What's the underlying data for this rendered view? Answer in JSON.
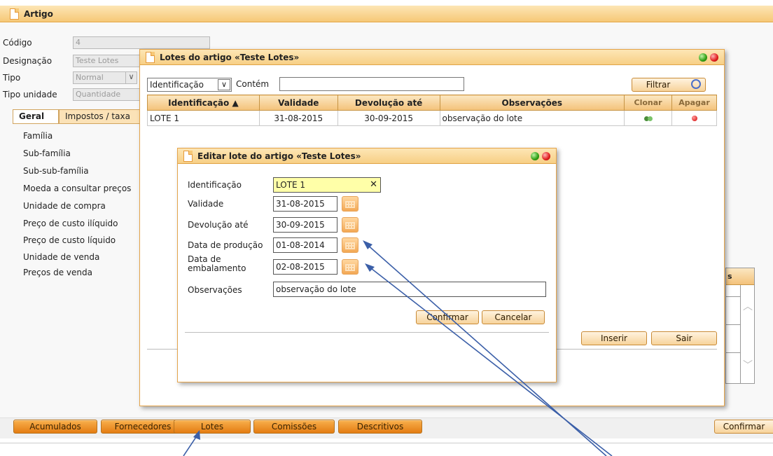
{
  "main": {
    "title": "Artigo",
    "fields": {
      "codigo_label": "Código",
      "codigo_value": "4",
      "designacao_label": "Designação",
      "designacao_value": "Teste Lotes",
      "tipo_label": "Tipo",
      "tipo_value": "Normal",
      "tipo_unidade_label": "Tipo unidade",
      "tipo_unidade_value": "Quantidade"
    },
    "tabs": [
      "Geral",
      "Impostos / taxa"
    ],
    "side_items": [
      "Família",
      "Sub-família",
      "Sub-sub-família",
      "Moeda a consultar preços",
      "Unidade de compra",
      "Preço de custo ilíquido",
      "Preço de custo líquido",
      "Unidade de venda",
      "Preços de venda"
    ],
    "bottom_buttons": [
      "Acumulados",
      "Fornecedores",
      "Lotes",
      "Comissões",
      "Descritivos"
    ],
    "confirm_label": "Confirmar",
    "right_table_header": "s"
  },
  "lotes_window": {
    "title": "Lotes do artigo «Teste Lotes»",
    "filter_field": "Identificação",
    "filter_op": "Contém",
    "filter_value": "",
    "filter_button": "Filtrar",
    "columns": [
      "Identificação ▲",
      "Validade",
      "Devolução até",
      "Observações",
      "Clonar",
      "Apagar"
    ],
    "rows": [
      {
        "identificacao": "LOTE 1",
        "validade": "31-08-2015",
        "devolucao": "30-09-2015",
        "observacoes": "observação do lote"
      }
    ],
    "insert_button": "Inserir",
    "exit_button": "Sair"
  },
  "edit_dialog": {
    "title": "Editar lote do artigo «Teste Lotes»",
    "labels": {
      "identificacao": "Identificação",
      "validade": "Validade",
      "devolucao": "Devolução até",
      "producao": "Data de produção",
      "embalamento_1": "Data de",
      "embalamento_2": "embalamento",
      "observacoes": "Observações"
    },
    "values": {
      "identificacao": "LOTE 1",
      "validade": "31-08-2015",
      "devolucao": "30-09-2015",
      "producao": "01-08-2014",
      "embalamento": "02-08-2015",
      "observacoes": "observação do lote"
    },
    "confirm_button": "Confirmar",
    "cancel_button": "Cancelar",
    "clear_glyph": "✕"
  },
  "colors": {
    "accent_orange": "#e47c12",
    "title_bar": "#f6c877",
    "highlight_input": "#ffffa8",
    "annotation_arrow": "#3b5fa8"
  }
}
